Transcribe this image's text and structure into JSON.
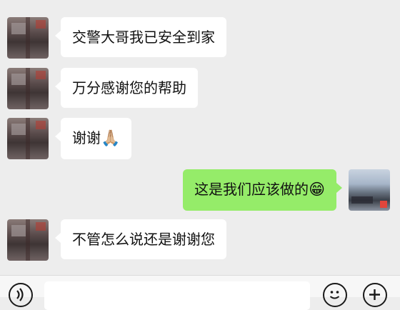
{
  "messages": [
    {
      "side": "left",
      "text": "交警大哥我已安全到家"
    },
    {
      "side": "left",
      "text": "万分感谢您的帮助"
    },
    {
      "side": "left",
      "text": "谢谢",
      "emoji": "🙏🏼"
    },
    {
      "side": "right",
      "text": "这是我们应该做的",
      "emoji": "😁"
    },
    {
      "side": "left",
      "text": "不管怎么说还是谢谢您"
    }
  ],
  "bottom_bar": {
    "voice_icon": "voice-icon",
    "emoji_icon": "emoji-icon",
    "plus_icon": "plus-icon",
    "input_value": ""
  },
  "colors": {
    "background": "#ededed",
    "incoming_bubble": "#ffffff",
    "outgoing_bubble": "#95ec69"
  }
}
